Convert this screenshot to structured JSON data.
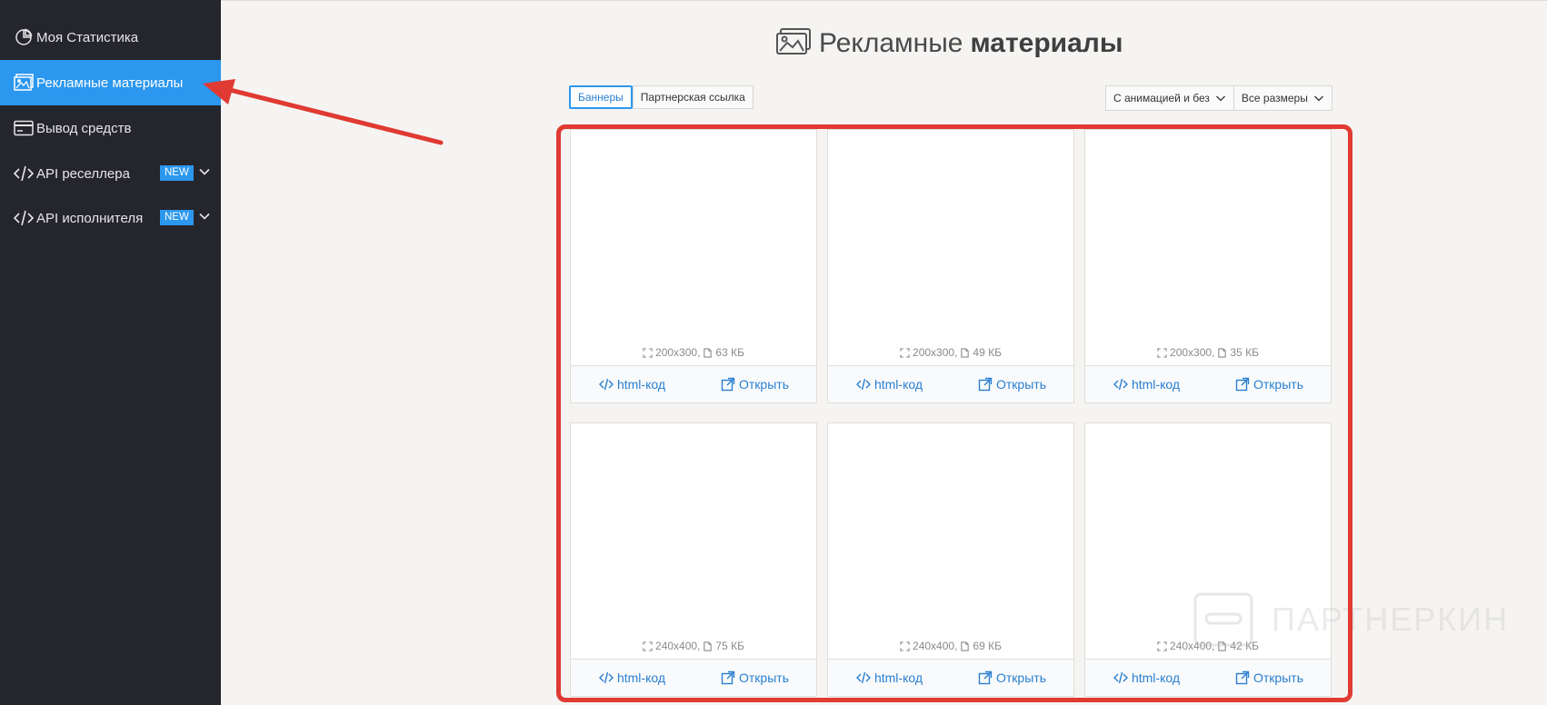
{
  "sidebar": {
    "items": [
      {
        "label": "Моя Статистика",
        "icon": "pie-chart-icon"
      },
      {
        "label": "Рекламные материалы",
        "icon": "image-icon"
      },
      {
        "label": "Вывод средств",
        "icon": "credit-card-icon"
      },
      {
        "label": "API реселлера",
        "icon": "code-icon",
        "badge": "NEW"
      },
      {
        "label": "API исполнителя",
        "icon": "code-icon",
        "badge": "NEW"
      }
    ],
    "active_index": 1
  },
  "header": {
    "title_light": "Рекламные",
    "title_bold": "материалы"
  },
  "tabs": [
    {
      "label": "Баннеры",
      "active": true
    },
    {
      "label": "Партнерская ссылка",
      "active": false
    }
  ],
  "filters": {
    "animation": "С анимацией и без",
    "sizes": "Все размеры"
  },
  "banners": [
    {
      "dims": "200x300,",
      "size": "63 КБ"
    },
    {
      "dims": "200x300,",
      "size": "49 КБ"
    },
    {
      "dims": "200x300,",
      "size": "35 КБ"
    },
    {
      "dims": "240x400,",
      "size": "75 КБ"
    },
    {
      "dims": "240x400,",
      "size": "69 КБ"
    },
    {
      "dims": "240x400,",
      "size": "42 КБ"
    }
  ],
  "card_actions": {
    "code_label": "html-код",
    "open_label": "Открыть"
  },
  "watermark": "ПАРТНЕРКИН",
  "colors": {
    "sidebar_bg": "#25252d",
    "accent": "#2b97ee",
    "annotation_red": "#e03a33",
    "link": "#2b7fd0"
  }
}
